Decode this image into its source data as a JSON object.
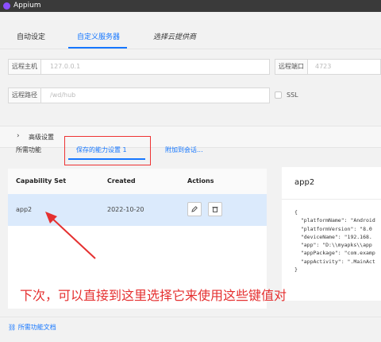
{
  "window": {
    "title": "Appium"
  },
  "tabs": [
    {
      "label": "自动设定"
    },
    {
      "label": "自定义服务器"
    },
    {
      "label": "选择云提供商"
    }
  ],
  "server": {
    "host_label": "远程主机",
    "host_placeholder": "127.0.0.1",
    "port_label": "远程端口",
    "port_placeholder": "4723",
    "path_label": "远程路径",
    "path_placeholder": "/wd/hub",
    "ssl_label": "SSL"
  },
  "advanced": {
    "label": "高级设置"
  },
  "cap_tabs": [
    {
      "label": "所需功能"
    },
    {
      "label": "保存的能力设置 1"
    },
    {
      "label": "附加到会话..."
    }
  ],
  "table": {
    "headers": [
      "Capability Set",
      "Created",
      "Actions"
    ],
    "rows": [
      {
        "name": "app2",
        "created": "2022-10-20"
      }
    ]
  },
  "panel": {
    "title": "app2",
    "code_lines": [
      "{",
      "  \"platformName\": \"Android",
      "  \"platformVersion\": \"8.0",
      "  \"deviceName\": \"192.168.",
      "  \"app\": \"D:\\\\myapks\\\\app",
      "  \"appPackage\": \"com.examp",
      "  \"appActivity\": \".MainAct",
      "}"
    ]
  },
  "annotation": {
    "text": "下次，可以直接到这里选择它来使用这些键值对"
  },
  "footer": {
    "doc_link": "所需功能文档"
  },
  "colors": {
    "accent": "#1677ff",
    "annotation": "#e53030",
    "selected_row": "#dbeafc"
  }
}
